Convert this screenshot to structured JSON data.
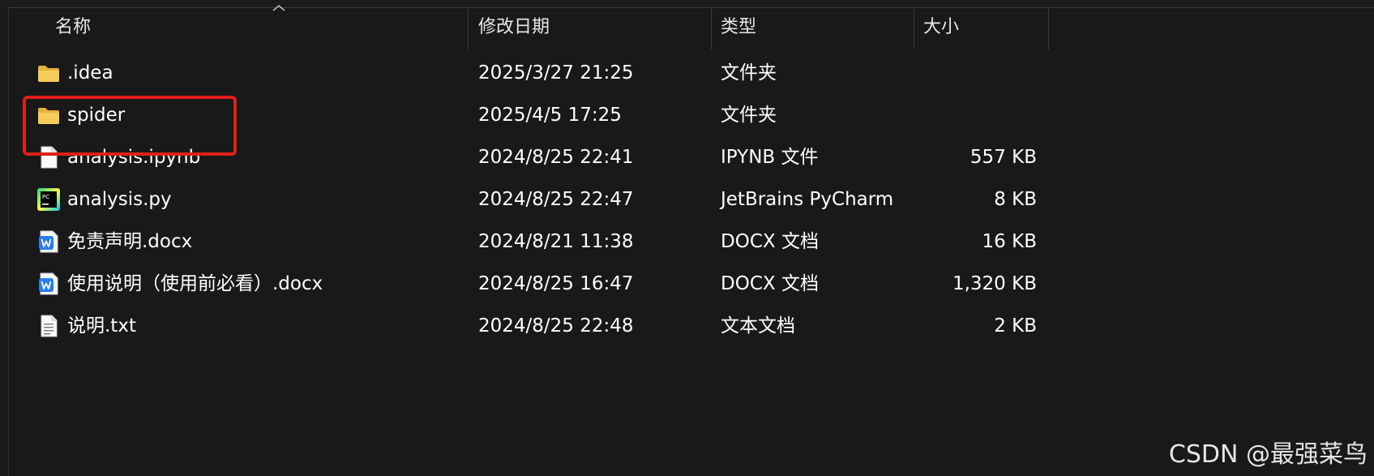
{
  "columns": {
    "name": "名称",
    "modified": "修改日期",
    "type": "类型",
    "size": "大小"
  },
  "files": [
    {
      "name": ".idea",
      "modified": "2025/3/27 21:25",
      "type": "文件夹",
      "size": "",
      "icon": "folder-icon"
    },
    {
      "name": "spider",
      "modified": "2025/4/5 17:25",
      "type": "文件夹",
      "size": "",
      "icon": "folder-icon"
    },
    {
      "name": "analysis.ipynb",
      "modified": "2024/8/25 22:41",
      "type": "IPYNB 文件",
      "size": "557 KB",
      "icon": "blank-file-icon"
    },
    {
      "name": "analysis.py",
      "modified": "2024/8/25 22:47",
      "type": "JetBrains PyCharm",
      "size": "8 KB",
      "icon": "pycharm-file-icon"
    },
    {
      "name": "免责声明.docx",
      "modified": "2024/8/21 11:38",
      "type": "DOCX 文档",
      "size": "16 KB",
      "icon": "wps-word-file-icon"
    },
    {
      "name": "使用说明（使用前必看）.docx",
      "modified": "2024/8/25 16:47",
      "type": "DOCX 文档",
      "size": "1,320 KB",
      "icon": "wps-word-file-icon"
    },
    {
      "name": "说明.txt",
      "modified": "2024/8/25 22:48",
      "type": "文本文档",
      "size": "2 KB",
      "icon": "text-file-icon"
    }
  ],
  "highlighted_item": "spider",
  "colors": {
    "background": "#191919",
    "folder": "#f2c94c",
    "highlight_border": "#e0201a"
  },
  "watermark": "CSDN @最强菜鸟"
}
